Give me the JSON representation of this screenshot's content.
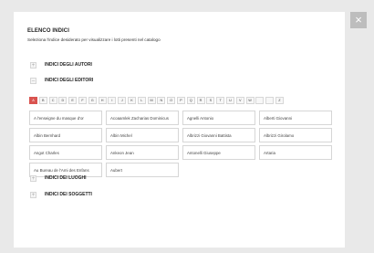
{
  "catalog": {
    "title": "ELENCO INDICI",
    "subtitle": "Seleziona l'indice desiderato per visualizzare i lotti presenti nel catalogo",
    "close_label": "×",
    "sections": {
      "autori": {
        "symbol": "+",
        "label": "INDICI DEGLI AUTORI"
      },
      "editori": {
        "symbol": "–",
        "label": "INDICI DEGLI EDITORI"
      },
      "luoghi": {
        "symbol": "+",
        "label": "INDICI DEI LUOGHI"
      },
      "soggetti": {
        "symbol": "+",
        "label": "INDICI DEI SOGGETTI"
      }
    },
    "alphabet": [
      "A",
      "B",
      "C",
      "D",
      "E",
      "F",
      "G",
      "H",
      "I",
      "J",
      "K",
      "L",
      "M",
      "N",
      "O",
      "P",
      "Q",
      "R",
      "S",
      "T",
      "U",
      "V",
      "W",
      "",
      "",
      "Z"
    ],
    "active_letter": "A",
    "publishers": [
      "A l'enseigne du masque d'or",
      "Acoaamlek Zacharias Dominicus",
      "Agnelli Antonio",
      "Alberti Giovanni",
      "Albin Bernhard",
      "Albin Michel",
      "Albrizzi Giovanni Battista",
      "Albrizzi Girolamo",
      "Angot Charles",
      "Ankeon Jean",
      "Antonelli Giuseppe",
      "Artaria",
      "Au Bureau de l'Ami des Enfans",
      "Aubert"
    ]
  }
}
